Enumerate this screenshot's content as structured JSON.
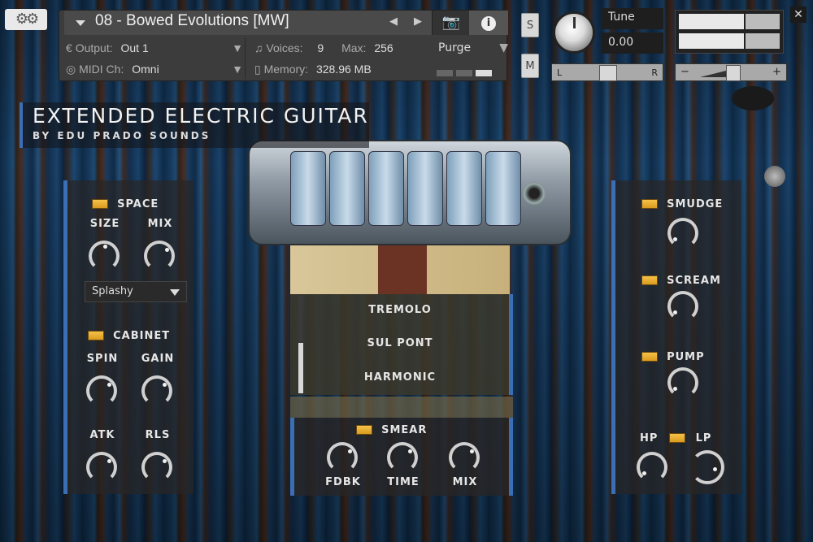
{
  "header": {
    "instrument_name": "08 - Bowed Evolutions [MW]",
    "prev_arrow": "◀",
    "next_arrow": "▶",
    "output_label": "Output:",
    "output_value": "Out 1",
    "voices_label": "Voices:",
    "voices_value": "9",
    "max_label": "Max:",
    "max_value": "256",
    "purge_label": "Purge",
    "midi_label": "MIDI Ch:",
    "midi_value": "Omni",
    "memory_label": "Memory:",
    "memory_value": "328.96 MB",
    "solo_label": "S",
    "mute_label": "M",
    "tune_label": "Tune",
    "tune_value": "0.00",
    "pan_left": "L",
    "pan_right": "R",
    "vol_minus": "−",
    "vol_plus": "+",
    "close_symbol": "✕"
  },
  "brand": {
    "title": "EXTENDED ELECTRIC GUITAR",
    "subtitle": "BY EDU PRADO SOUNDS"
  },
  "left_panel": {
    "space": {
      "label": "SPACE",
      "size_label": "SIZE",
      "mix_label": "MIX",
      "reverb_type": "Splashy"
    },
    "cabinet": {
      "label": "CABINET",
      "spin_label": "SPIN",
      "gain_label": "GAIN",
      "atk_label": "ATK",
      "rls_label": "RLS"
    }
  },
  "center_panel": {
    "articulations": [
      "TREMOLO",
      "SUL PONT",
      "HARMONIC"
    ],
    "smear": {
      "label": "SMEAR",
      "fdbk_label": "FDBK",
      "time_label": "TIME",
      "mix_label": "MIX"
    }
  },
  "right_panel": {
    "smudge_label": "SMUDGE",
    "scream_label": "SCREAM",
    "pump_label": "PUMP",
    "hp_label": "HP",
    "lp_label": "LP"
  },
  "colors": {
    "accent_blue": "#3b6fb5",
    "led_amber": "#e8ad2f"
  }
}
